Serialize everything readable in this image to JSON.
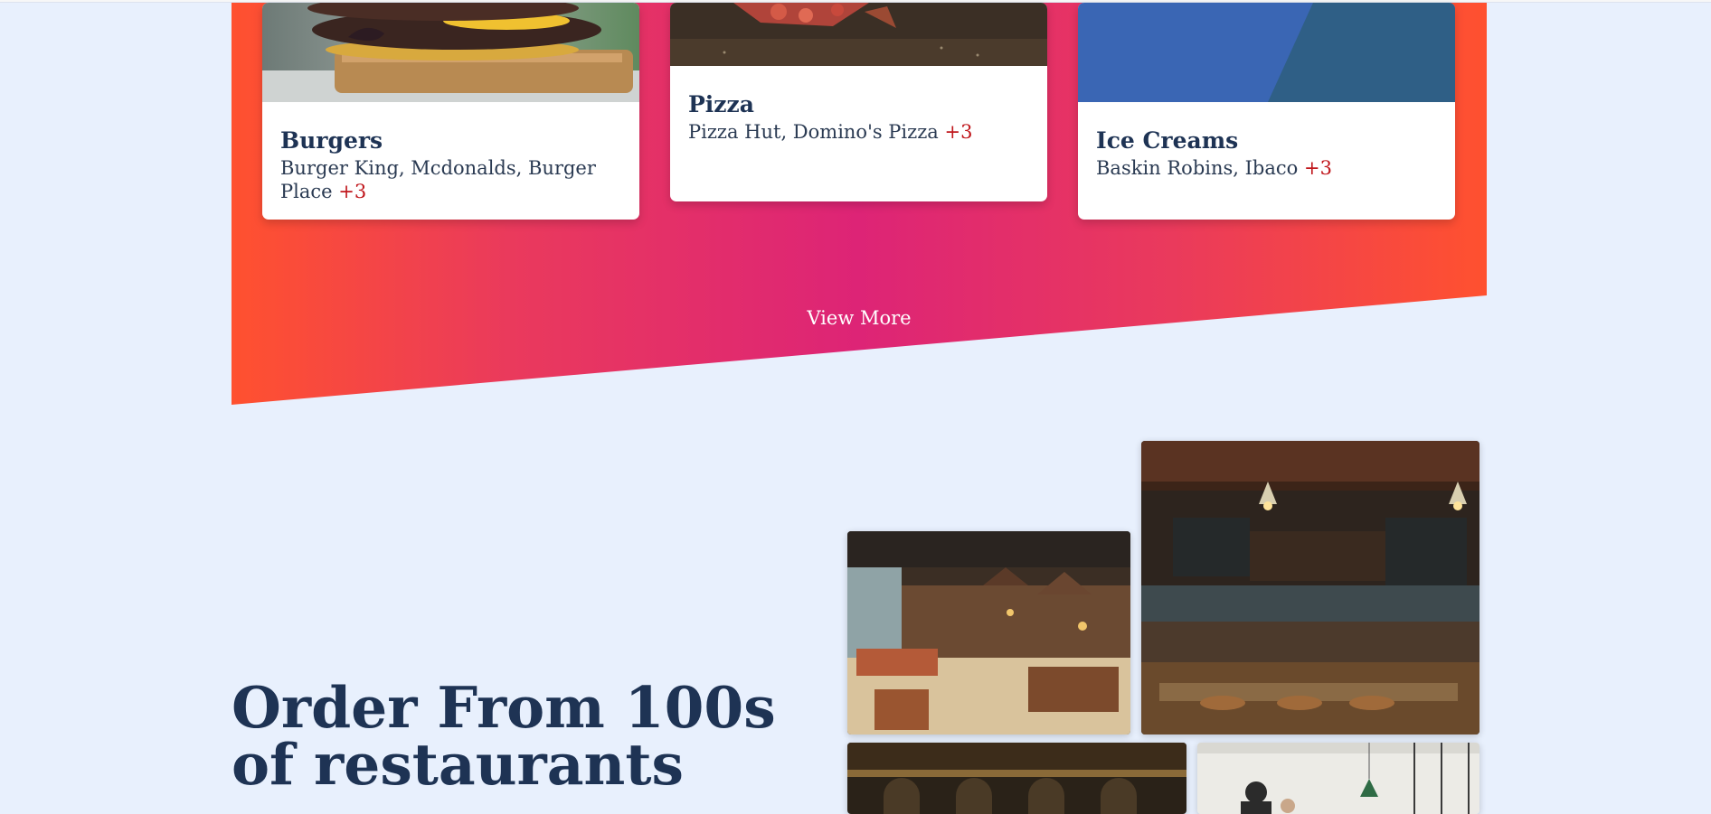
{
  "categories": [
    {
      "title": "Burgers",
      "places": "Burger King, Mcdonalds, Burger Place",
      "more": "+3"
    },
    {
      "title": "Pizza",
      "places": "Pizza Hut, Domino's Pizza",
      "more": "+3"
    },
    {
      "title": "Ice Creams",
      "places": "Baskin Robins, Ibaco",
      "more": "+3"
    }
  ],
  "view_more_label": "View More",
  "headline": "Order From 100s of restaurants",
  "colors": {
    "background": "#e8f0fd",
    "gradient_edge": "#ff512f",
    "gradient_center": "#dd2476",
    "heading": "#1e3354",
    "accent_count": "#c0171c"
  }
}
